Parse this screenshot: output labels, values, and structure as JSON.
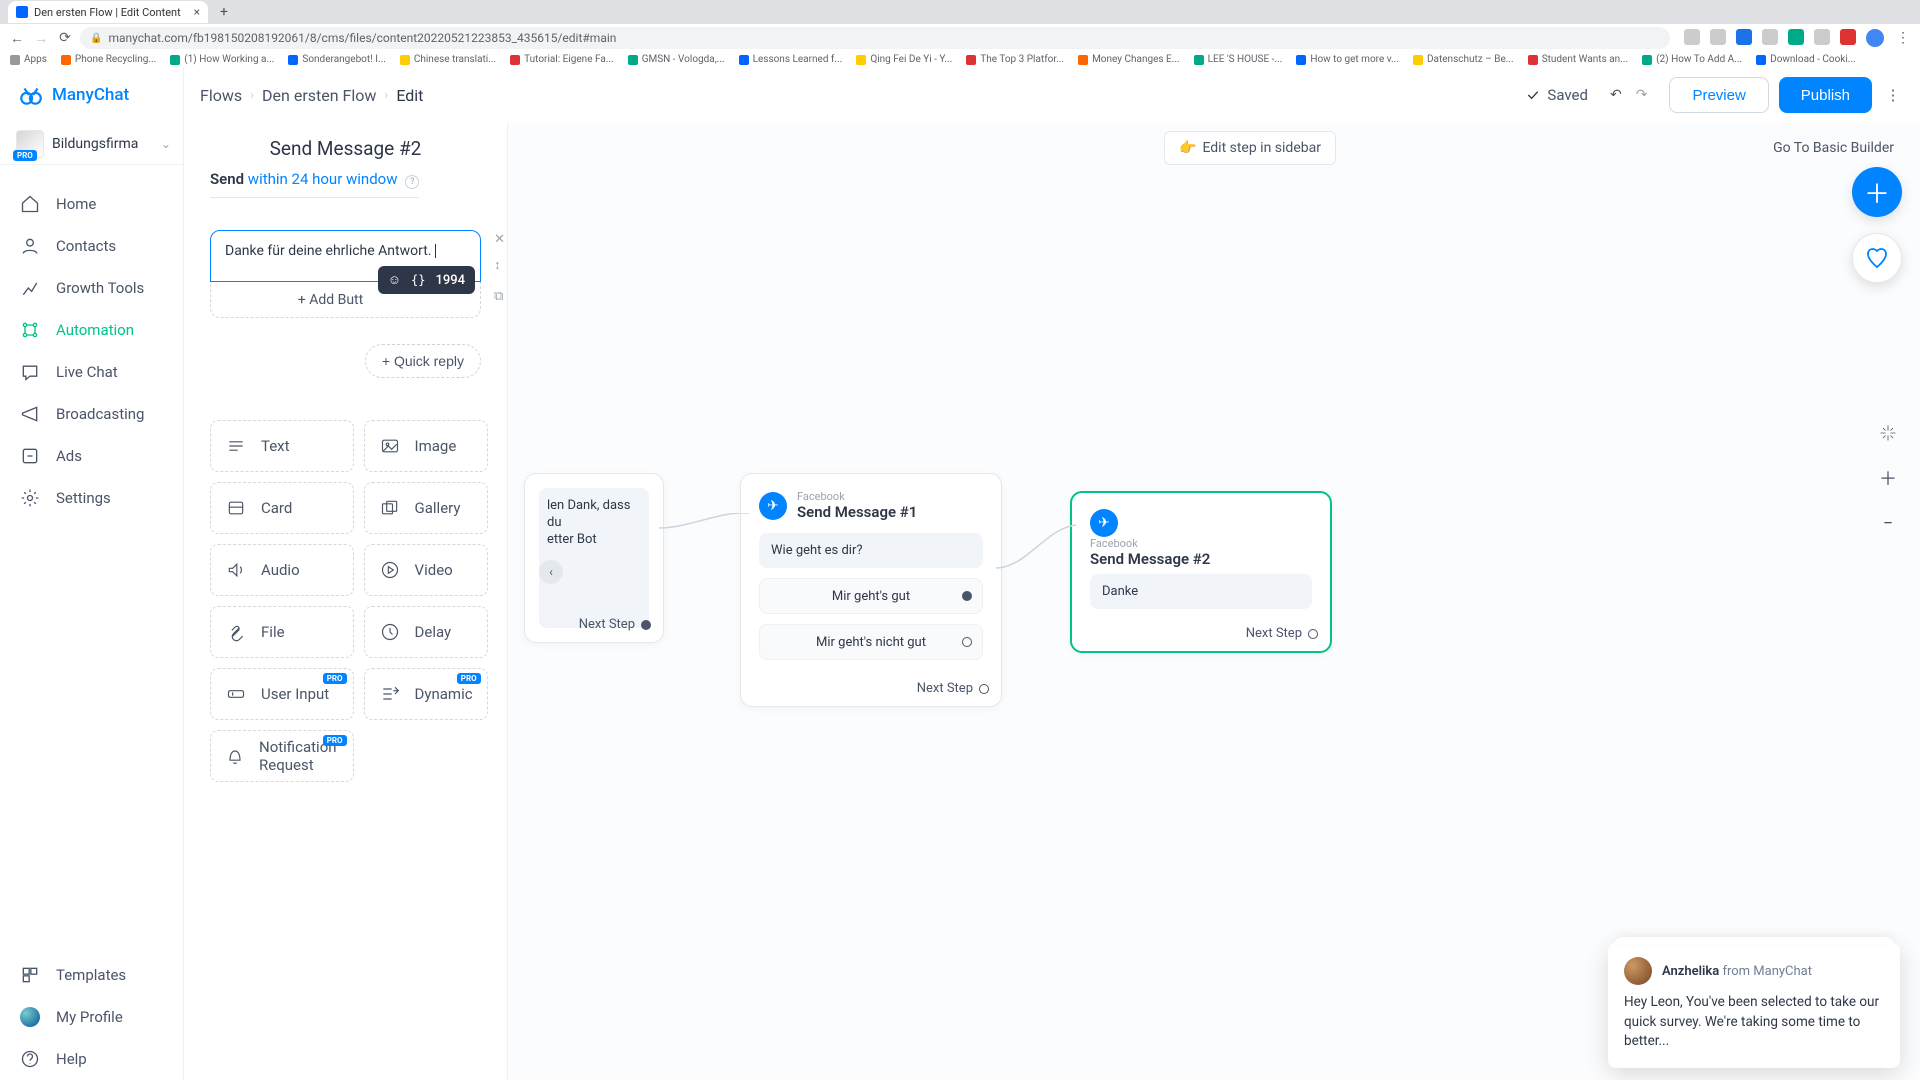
{
  "browser": {
    "tab_title": "Den ersten Flow | Edit Content",
    "url": "manychat.com/fb198150208192061/8/cms/files/content20220521223853_435615/edit#main",
    "bookmarks": [
      "Apps",
      "Phone Recycling...",
      "(1) How Working a...",
      "Sonderangebot! I...",
      "Chinese translati...",
      "Tutorial: Eigene Fa...",
      "GMSN - Vologda,...",
      "Lessons Learned f...",
      "Qing Fei De Yi - Y...",
      "The Top 3 Platfor...",
      "Money Changes E...",
      "LEE 'S HOUSE -...",
      "How to get more v...",
      "Datenschutz – Be...",
      "Student Wants an...",
      "(2) How To Add A...",
      "Download - Cooki..."
    ]
  },
  "app_name": "ManyChat",
  "workspace": {
    "name": "Bildungsfirma",
    "badge": "PRO"
  },
  "nav": {
    "home": "Home",
    "contacts": "Contacts",
    "growth": "Growth Tools",
    "automation": "Automation",
    "livechat": "Live Chat",
    "broadcasting": "Broadcasting",
    "ads": "Ads",
    "settings": "Settings",
    "templates": "Templates",
    "profile": "My Profile",
    "help": "Help"
  },
  "header": {
    "crumbs": [
      "Flows",
      "Den ersten Flow",
      "Edit"
    ],
    "saved": "Saved",
    "preview": "Preview",
    "publish": "Publish"
  },
  "canvas": {
    "edit_sidebar": "Edit step in sidebar",
    "go_basic": "Go To Basic Builder",
    "node0_text": "len Dank, dass du\netter Bot",
    "next_step": "Next Step",
    "node1": {
      "channel": "Facebook",
      "title": "Send Message #1",
      "question": "Wie geht es dir?",
      "reply_a": "Mir geht's gut",
      "reply_b": "Mir geht's nicht gut"
    },
    "node2": {
      "channel": "Facebook",
      "title": "Send Message #2",
      "preview": "Danke"
    }
  },
  "editor": {
    "title": "Send Message #2",
    "send_label": "Send",
    "send_window": "within 24 hour window",
    "message_text": "Danke für deine ehrliche Antwort. ",
    "char_count": "1994",
    "add_button": "+ Add Butt",
    "quick_reply": "+ Quick reply",
    "blocks": {
      "text": "Text",
      "image": "Image",
      "card": "Card",
      "gallery": "Gallery",
      "audio": "Audio",
      "video": "Video",
      "file": "File",
      "delay": "Delay",
      "user_input": "User Input",
      "dynamic": "Dynamic",
      "notif": "Notification Request"
    },
    "pro_badge": "PRO"
  },
  "chat": {
    "author": "Anzhelika",
    "from": " from ManyChat",
    "body": "Hey Leon,  You've been selected to take our quick survey. We're taking some time to better..."
  }
}
